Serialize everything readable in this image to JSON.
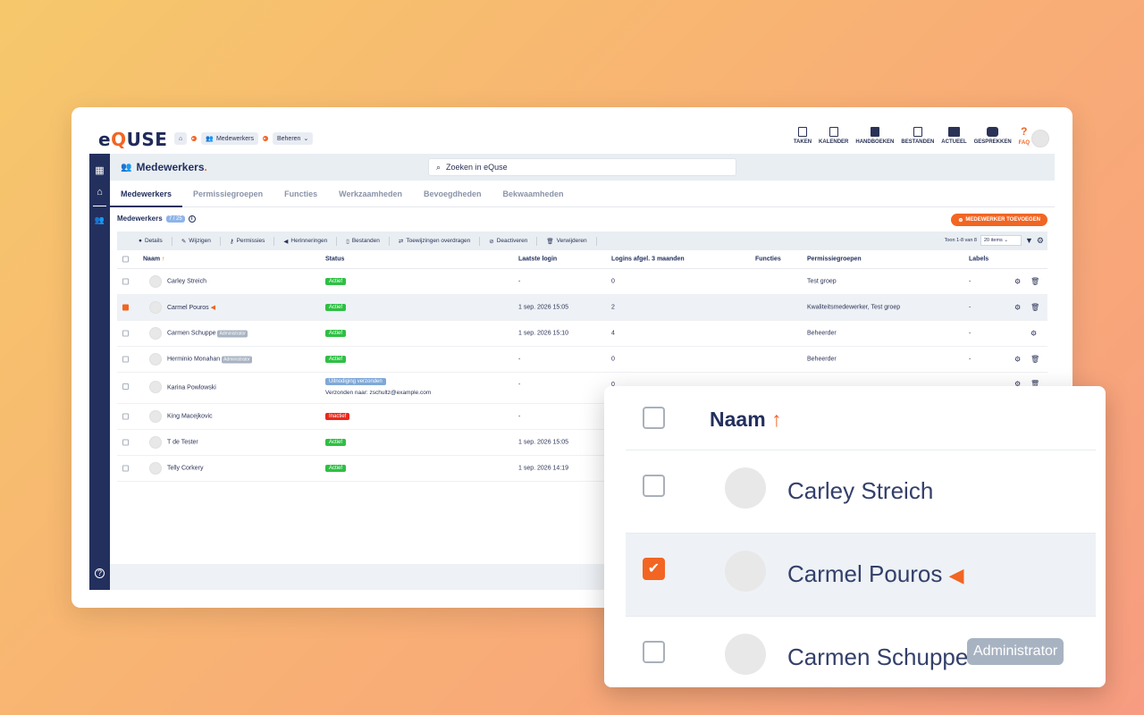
{
  "brand": {
    "logo_a": "e",
    "logo_q": "Q",
    "logo_b": "USE"
  },
  "breadcrumb": {
    "item1": "Medewerkers",
    "item2": "Beheren"
  },
  "topnav": [
    "TAKEN",
    "KALENDER",
    "HANDBOEKEN",
    "BESTANDEN",
    "ACTUEEL",
    "GESPREKKEN",
    "FAQ"
  ],
  "page": {
    "title": "Medewerkers",
    "title_dot": "."
  },
  "search": {
    "placeholder": "Zoeken in eQuse"
  },
  "tabs": [
    "Medewerkers",
    "Permissiegroepen",
    "Functies",
    "Werkzaamheden",
    "Bevoegdheden",
    "Bekwaamheden"
  ],
  "list": {
    "title": "Medewerkers",
    "count": "7 / 25",
    "add_button": "MEDEWERKER TOEVOEGEN"
  },
  "actions": [
    "Details",
    "Wijzigen",
    "Permissies",
    "Herinneringen",
    "Bestanden",
    "Toewijzingen overdragen",
    "Deactiveren",
    "Verwijderen"
  ],
  "pagination": {
    "range": "Toon 1-8 van 8",
    "per_page": "20 items"
  },
  "columns": [
    "Naam",
    "Status",
    "Laatste login",
    "Logins afgel. 3 maanden",
    "Functies",
    "Permissiegroepen",
    "Labels"
  ],
  "rows": [
    {
      "name": "Carley Streich",
      "status": "Actief",
      "last_login": "-",
      "logins": "0",
      "groups": "Test groep",
      "labels": "-"
    },
    {
      "name": "Carmel Pouros",
      "status": "Actief",
      "last_login": "1 sep. 2026 15:05",
      "logins": "2",
      "groups": "Kwaliteitsmedewerker, Test groep",
      "labels": "-"
    },
    {
      "name": "Carmen Schuppe",
      "badge": "Administrator",
      "status": "Actief",
      "last_login": "1 sep. 2026 15:10",
      "logins": "4",
      "groups": "Beheerder",
      "labels": "-"
    },
    {
      "name": "Herminio Monahan",
      "badge": "Administrator",
      "status": "Actief",
      "last_login": "-",
      "logins": "0",
      "groups": "Beheerder",
      "labels": "-"
    },
    {
      "name": "Karina Powlowski",
      "status": "Uitnodiging verzonden",
      "sent_to": "Verzonden naar: zschultz@example.com",
      "last_login": "-",
      "logins": "0"
    },
    {
      "name": "King Macejkovic",
      "status": "Inactief",
      "last_login": "-"
    },
    {
      "name": "T de Tester",
      "status": "Actief",
      "last_login": "1 sep. 2026 15:05"
    },
    {
      "name": "Telly Corkery",
      "status": "Actief",
      "last_login": "1 sep. 2026 14:19"
    }
  ],
  "zoom": {
    "header": "Naam",
    "rows": [
      {
        "name": "Carley Streich"
      },
      {
        "name": "Carmel Pouros"
      },
      {
        "name": "Carmen Schuppe",
        "badge": "Administrator"
      }
    ]
  },
  "colors": {
    "brand": "#23305e",
    "accent": "#f26522",
    "active": "#2fbf44",
    "inactive": "#e8291c",
    "invited": "#7fa8d8"
  }
}
